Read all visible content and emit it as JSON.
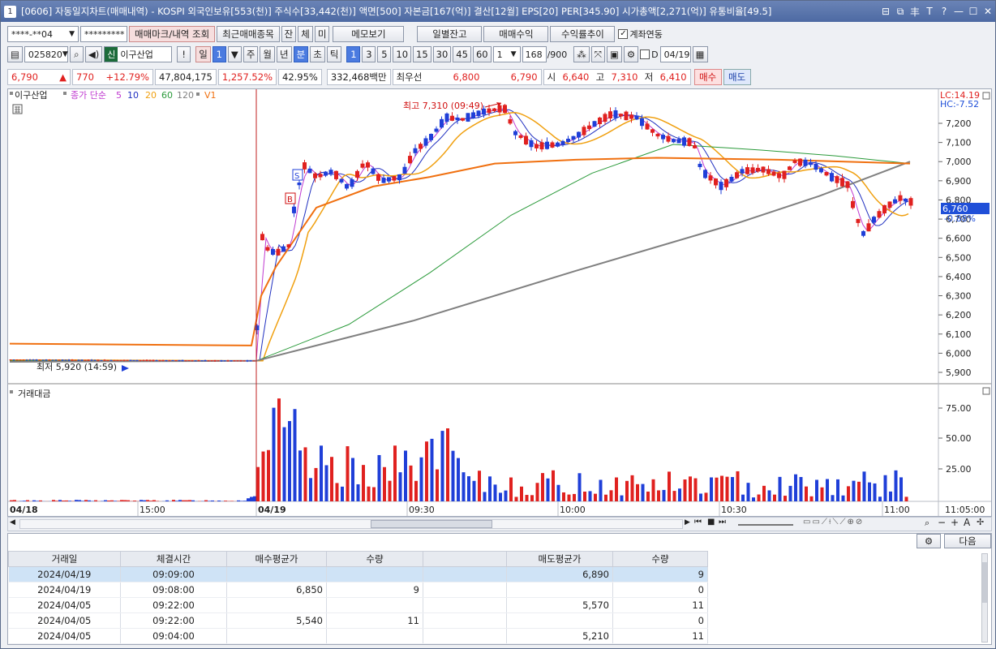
{
  "title": {
    "app_icon": "1",
    "text": "[0606] 자동일지차트(매매내역) - KOSPI 외국인보유[553(천)] 주식수[33,442(천)] 액면[500] 자본금[167(억)] 결산[12월] EPS[20] PER[345.90] 시가총액[2,271(억)] 유통비율[49.5]",
    "buttons": [
      "⊟",
      "⧉",
      "丰",
      "T",
      "?",
      "—",
      "☐",
      "✕"
    ]
  },
  "toolbar1": {
    "account": "****-**04",
    "password": "*********",
    "trade_mark_btn": "매매마크/내역 조회",
    "recent_items_btn": "최근매매종목",
    "balance_btn": "잔",
    "fill_btn": "체",
    "unfilled_btn": "미",
    "memo_btn": "메모보기",
    "daily_balance_btn": "일별잔고",
    "trade_profit_btn": "매매수익",
    "return_trend_btn": "수익률추이",
    "account_link_label": "계좌연동"
  },
  "toolbar2": {
    "code": "025820",
    "new_badge": "신",
    "stock_name": "이구산업",
    "alert_btn": "!",
    "period_day": "일",
    "period_day_count": "1",
    "period_week": "주",
    "period_month": "월",
    "period_year": "년",
    "period_minute": "분",
    "period_second": "초",
    "period_tick": "틱",
    "intervals": [
      "1",
      "3",
      "5",
      "10",
      "15",
      "30",
      "45",
      "60"
    ],
    "interval_count": "1",
    "data_count": "168",
    "data_total": "/900",
    "d_label": "D",
    "date": "04/19"
  },
  "quote": {
    "price": "6,790",
    "arrow": "▲",
    "change": "770",
    "change_rate": "+12.79%",
    "volume": "47,804,175",
    "volume_rate": "1,257.52%",
    "turnover_rate": "42.95%",
    "amount": "332,468백만",
    "best_bid_label": "최우선",
    "ask": "6,800",
    "bid": "6,790",
    "open_label": "시",
    "open": "6,640",
    "high_label": "고",
    "high": "7,310",
    "low_label": "저",
    "low": "6,410",
    "buy_btn": "매수",
    "sell_btn": "매도"
  },
  "chart": {
    "legend_name": "이구산업",
    "legend_ma_label": "종가 단순",
    "legend_ma": [
      "5",
      "10",
      "20",
      "60",
      "120"
    ],
    "legend_v": "V1",
    "lc_label": "LC:14.19",
    "hc_label": "HC:-7.52",
    "current_price": "6,760",
    "current_rate": "-0.88%",
    "high_annotation": "최고 7,310 (09:49)",
    "low_annotation": "최저 5,920 (14:59)",
    "buy_marker": "B",
    "sell_marker": "S",
    "y_ticks": [
      "7,200",
      "7,100",
      "7,000",
      "6,900",
      "6,800",
      "6,700",
      "6,600",
      "6,500",
      "6,400",
      "6,300",
      "6,200",
      "6,100",
      "6,000",
      "5,900"
    ],
    "volume_title": "거래대금",
    "vol_ticks": [
      "75.00",
      "50.00",
      "25.00"
    ],
    "x_labels": [
      "04/18",
      "15:00",
      "04/19",
      "09:30",
      "10:00",
      "10:30",
      "11:00",
      "11:05:00"
    ]
  },
  "bottom": {
    "next_btn": "다음"
  },
  "table": {
    "headers": [
      "거래일",
      "체결시간",
      "매수평균가",
      "수량",
      "",
      "매도평균가",
      "수량"
    ],
    "rows": [
      [
        "2024/04/19",
        "09:09:00",
        "",
        "",
        "",
        "6,890",
        "9"
      ],
      [
        "2024/04/19",
        "09:08:00",
        "6,850",
        "9",
        "",
        "",
        "0"
      ],
      [
        "2024/04/05",
        "09:22:00",
        "",
        "",
        "",
        "5,570",
        "11"
      ],
      [
        "2024/04/05",
        "09:22:00",
        "5,540",
        "11",
        "",
        "",
        "0"
      ],
      [
        "2024/04/05",
        "09:04:00",
        "",
        "",
        "",
        "5,210",
        "11"
      ]
    ]
  },
  "colors": {
    "up": "#e0211f",
    "down": "#1f3fd8",
    "ma5": "#c03ad0",
    "ma10": "#2030c0",
    "ma20": "#f0a010",
    "ma60": "#2a9a3a",
    "ma120": "#808080",
    "vwap": "#f07010"
  }
}
